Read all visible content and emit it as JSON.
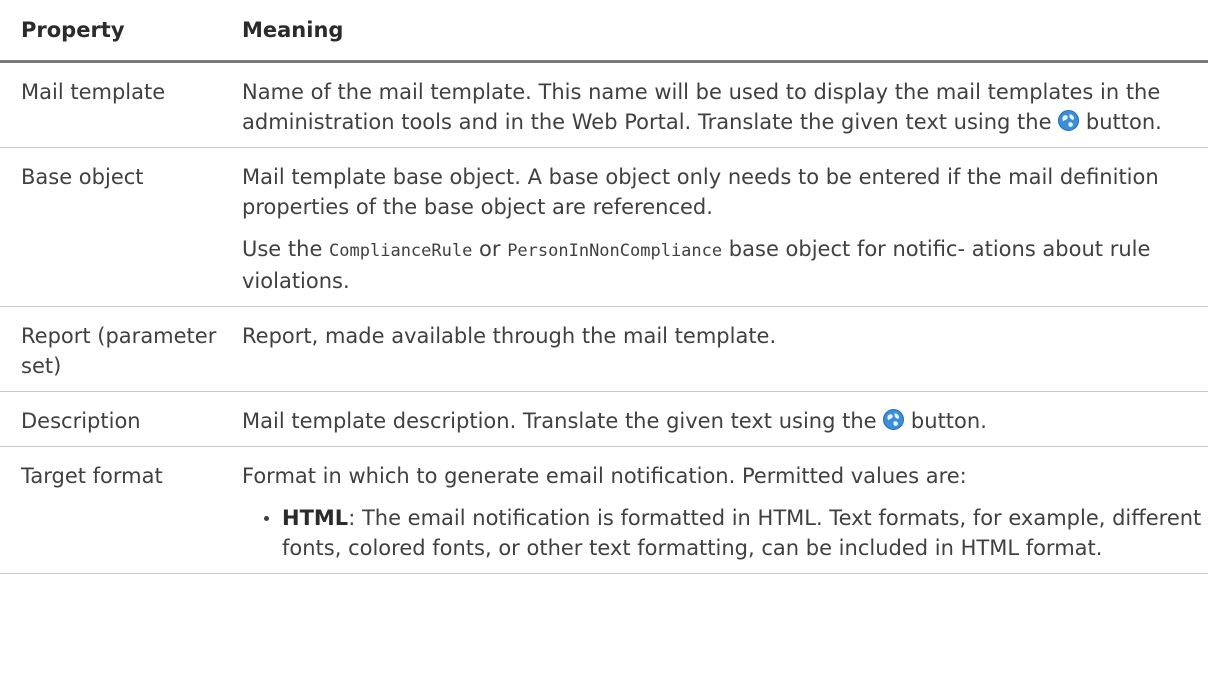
{
  "table": {
    "header": {
      "property": "Property",
      "meaning": "Meaning"
    },
    "rows": [
      {
        "property": "Mail template",
        "meaning_pre": "Name of the mail template. This name will be used to display the mail templates in the administration tools and in the Web Portal. Translate the given text using the ",
        "meaning_post": " button."
      },
      {
        "property": "Base object",
        "meaning_p1": "Mail template base object. A base object only needs to be entered if the mail definition properties of the base object are referenced.",
        "p2_a": "Use the ",
        "p2_code1": "ComplianceRule",
        "p2_b": " or ",
        "p2_code2": "PersonInNonCompliance",
        "p2_c": " base object for notific- ations about rule violations."
      },
      {
        "property": "Report (parameter set)",
        "meaning": "Report, made available through the mail template."
      },
      {
        "property": "Description",
        "meaning_pre": "Mail template description. Translate the given text using the ",
        "meaning_post": " button."
      },
      {
        "property": "Target format",
        "meaning_p1": "Format in which to generate email notification. Permitted values are:",
        "bullet_term": "HTML",
        "bullet_text": ": The email notification is formatted in HTML. Text formats, for example, different fonts, colored fonts, or other text formatting, can be included in HTML format."
      }
    ]
  },
  "icons": {
    "translate": "globe-icon",
    "translate_color": "#3a8fd8"
  }
}
